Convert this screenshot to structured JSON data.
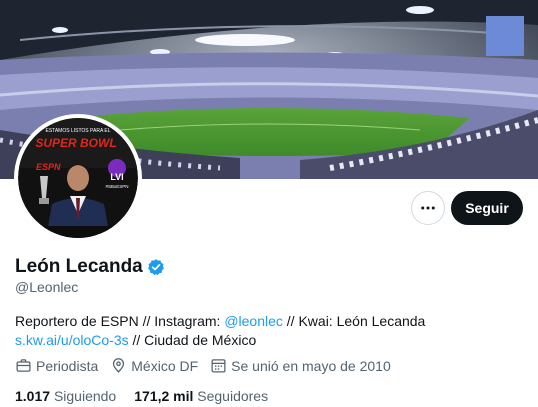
{
  "profile": {
    "display_name": "León Lecanda",
    "handle": "@Leonlec",
    "verified": true,
    "bio": {
      "part1": "Reportero de ESPN // Instagram: ",
      "instagram_link": "@leonlec",
      "part2": " // Kwai: León Lecanda ",
      "kwai_link": "s.kw.ai/u/oloCo-3s",
      "part3": " // Ciudad de México"
    },
    "meta": {
      "profession": "Periodista",
      "location": "México DF",
      "joined": "Se unió en mayo de 2010"
    },
    "stats": {
      "following_count": "1.017",
      "following_label": "Siguiendo",
      "followers_count": "171,2 mil",
      "followers_label": "Seguidores"
    }
  },
  "avatar_text": {
    "badge_top": "ESTAMOS LISTOS PARA EL",
    "title": "SUPER BOWL",
    "brand": "ESPN",
    "numeral": "LVI",
    "tag": "#SBxESPN"
  },
  "actions": {
    "more_icon": "more-icon",
    "follow_label": "Seguir"
  },
  "colors": {
    "accent": "#1d9bf0",
    "button_dark": "#0f1419",
    "secondary_text": "#536471"
  }
}
